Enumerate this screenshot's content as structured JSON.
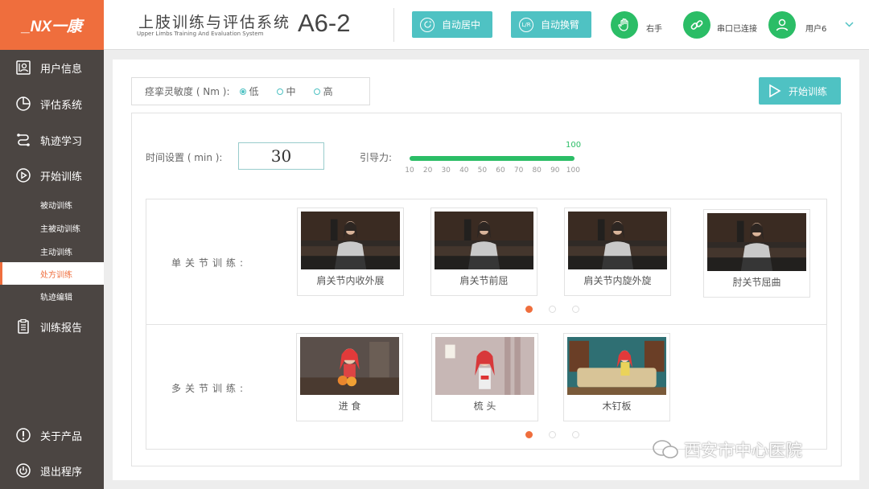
{
  "logo": {
    "text": "_NX一康"
  },
  "sidebar": {
    "items": [
      {
        "label": "用户信息",
        "icon": "user-card-icon"
      },
      {
        "label": "评估系统",
        "icon": "pie-chart-icon"
      },
      {
        "label": "轨迹学习",
        "icon": "path-icon"
      },
      {
        "label": "开始训练",
        "icon": "play-icon"
      }
    ],
    "subitems": [
      {
        "label": "被动训练"
      },
      {
        "label": "主被动训练"
      },
      {
        "label": "主动训练"
      },
      {
        "label": "处方训练",
        "active": true
      },
      {
        "label": "轨迹编辑"
      }
    ],
    "report": {
      "label": "训练报告",
      "icon": "clipboard-icon"
    },
    "about": {
      "label": "关于产品",
      "icon": "info-icon"
    },
    "exit": {
      "label": "退出程序",
      "icon": "power-icon"
    }
  },
  "header": {
    "title": "上肢训练与评估系统",
    "subtitle": "Upper Limbs Training And Evaluation System",
    "model": "A6-2",
    "auto_center": {
      "label": "自动居中",
      "icon_text": ""
    },
    "auto_switch": {
      "label": "自动换臂",
      "icon_text": "L/R"
    },
    "hand": {
      "label": "右手"
    },
    "serial": {
      "label": "串口已连接"
    },
    "user": {
      "label": "用户6"
    }
  },
  "controls": {
    "spasm_label": "痉挛灵敏度 ( Nm ):",
    "spasm_options": [
      {
        "label": "低",
        "selected": true
      },
      {
        "label": "中",
        "selected": false
      },
      {
        "label": "高",
        "selected": false
      }
    ],
    "start_label": "开始训练",
    "time_label": "时间设置 ( min ):",
    "time_value": "30",
    "guide_label": "引导力:",
    "guide_value": "100",
    "guide_ticks": [
      "10",
      "20",
      "30",
      "40",
      "50",
      "60",
      "70",
      "80",
      "90",
      "100"
    ]
  },
  "single": {
    "label": "单关节训练:",
    "cards": [
      {
        "name": "肩关节内收外展"
      },
      {
        "name": "肩关节前屈"
      },
      {
        "name": "肩关节内旋外旋"
      },
      {
        "name": "肘关节屈曲"
      }
    ],
    "page": 1,
    "pages": 3
  },
  "multi": {
    "label": "多关节训练:",
    "cards": [
      {
        "name": "进  食"
      },
      {
        "name": "梳  头"
      },
      {
        "name": "木钉板"
      }
    ],
    "page": 1,
    "pages": 3
  },
  "watermark": "西安市中心医院",
  "colors": {
    "accent": "#4fc2c3",
    "brand": "#ef6e3d",
    "green": "#2bbd66",
    "sidebar": "#4b4542"
  }
}
